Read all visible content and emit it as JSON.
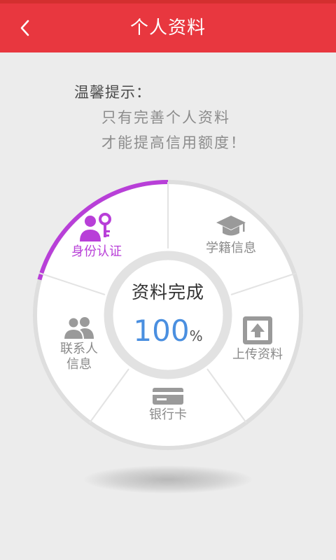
{
  "header": {
    "title": "个人资料"
  },
  "tips": {
    "label": "温馨提示：",
    "line1": "只有完善个人资料",
    "line2": "才能提高信用额度！"
  },
  "wheel": {
    "center_title": "资料完成",
    "progress_value": "100",
    "progress_unit": "%",
    "segments": [
      {
        "label": "身份认证",
        "icon": "users-key-icon",
        "active": true
      },
      {
        "label": "学籍信息",
        "icon": "graduation-cap-icon",
        "active": false
      },
      {
        "label": "上传资料",
        "icon": "upload-icon",
        "active": false
      },
      {
        "label": "银行卡",
        "icon": "bank-card-icon",
        "active": false
      },
      {
        "label_line1": "联系人",
        "label_line2": "信息",
        "icon": "contacts-icon",
        "active": false
      }
    ]
  },
  "colors": {
    "appbar": "#e8373f",
    "accent_purple": "#b83fd8",
    "progress_blue": "#4a8fe0",
    "inactive_gray": "#8a8a8a"
  }
}
